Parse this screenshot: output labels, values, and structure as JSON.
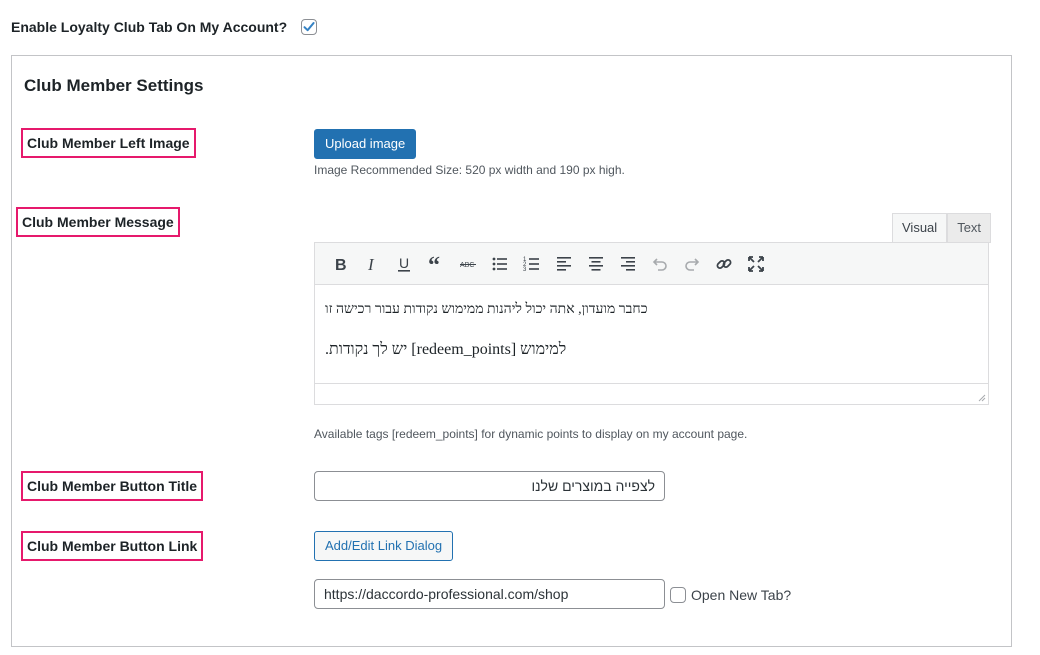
{
  "loyalty": {
    "label": "Enable Loyalty Club Tab On My Account?",
    "checked": true
  },
  "panel": {
    "title": "Club Member Settings",
    "left_image": {
      "label": "Club Member Left Image",
      "button_label": "Upload image",
      "hint": "Image Recommended Size: 520 px width and 190 px high."
    },
    "message": {
      "label": "Club Member Message",
      "tabs": [
        "Visual",
        "Text"
      ],
      "active_tab": "Visual",
      "line1": "כחבר מועדון, אתה יכול ליהנות ממימוש נקודות עבור רכישה זו",
      "line2": "למימוש [redeem_points] יש לך נקודות.",
      "hint": "Available tags [redeem_points] for dynamic points to display on my account page.",
      "toolbar": [
        "bold-icon",
        "italic-icon",
        "underline-icon",
        "blockquote-icon",
        "strikethrough-icon",
        "bullet-list-icon",
        "numbered-list-icon",
        "align-left-icon",
        "align-center-icon",
        "align-right-icon",
        "undo-icon",
        "redo-icon",
        "link-icon",
        "fullscreen-icon"
      ]
    },
    "button_title": {
      "label": "Club Member Button Title",
      "value": "לצפייה במוצרים שלנו"
    },
    "button_link": {
      "label": "Club Member Button Link",
      "button_label": "Add/Edit Link Dialog",
      "url": "https://daccordo-professional.com/shop",
      "new_tab_label": "Open New Tab?",
      "new_tab_checked": false
    }
  },
  "colors": {
    "primary": "#2271b1",
    "highlight": "#e6196c",
    "checkmark": "#3582c4"
  }
}
